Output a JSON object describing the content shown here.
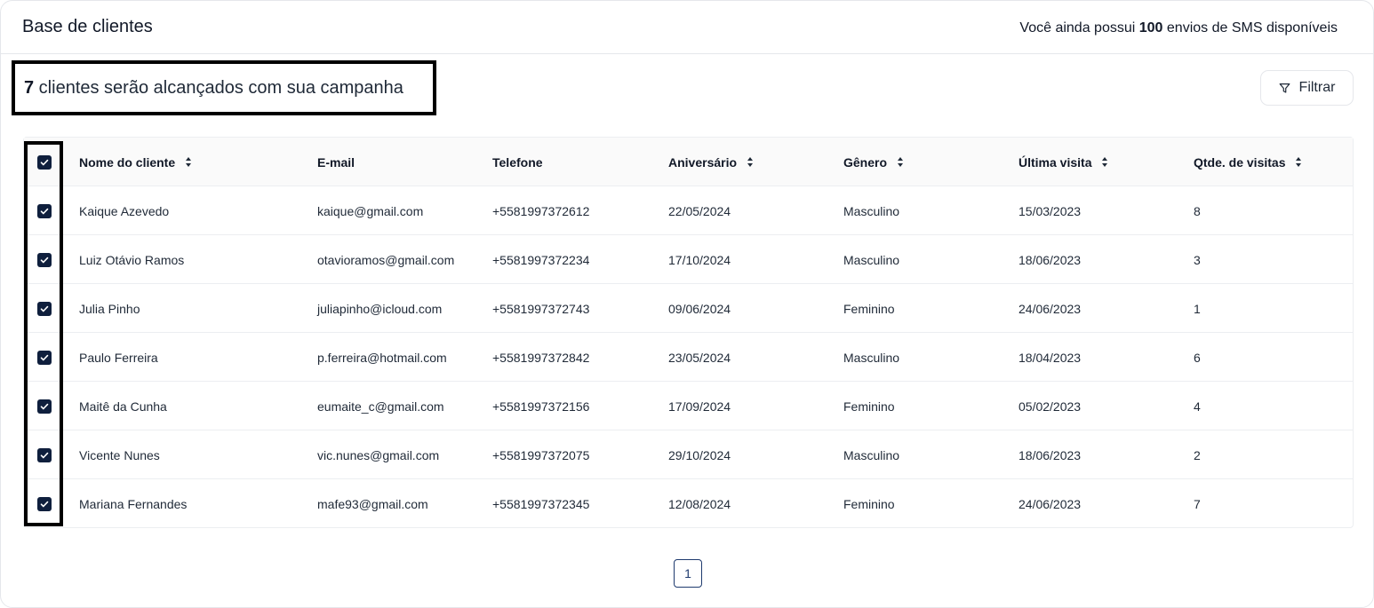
{
  "header": {
    "title": "Base de clientes",
    "sms_prefix": "Você ainda possui ",
    "sms_count": "100",
    "sms_suffix": " envios de SMS disponíveis"
  },
  "summary": {
    "count": "7",
    "text": " clientes serão alcançados com sua campanha"
  },
  "filter": {
    "label": "Filtrar",
    "icon": "filter-icon"
  },
  "table": {
    "columns": [
      {
        "label": "Nome do cliente",
        "sortable": true
      },
      {
        "label": "E-mail",
        "sortable": false
      },
      {
        "label": "Telefone",
        "sortable": false
      },
      {
        "label": "Aniversário",
        "sortable": true
      },
      {
        "label": "Gênero",
        "sortable": true
      },
      {
        "label": "Última visita",
        "sortable": true
      },
      {
        "label": "Qtde. de visitas",
        "sortable": true
      }
    ],
    "select_all_checked": true,
    "rows": [
      {
        "checked": true,
        "name": "Kaique Azevedo",
        "email": "kaique@gmail.com",
        "phone": "+5581997372612",
        "birthday": "22/05/2024",
        "gender": "Masculino",
        "last_visit": "15/03/2023",
        "visits": "8"
      },
      {
        "checked": true,
        "name": "Luiz Otávio Ramos",
        "email": "otavioramos@gmail.com",
        "phone": "+5581997372234",
        "birthday": "17/10/2024",
        "gender": "Masculino",
        "last_visit": "18/06/2023",
        "visits": "3"
      },
      {
        "checked": true,
        "name": "Julia Pinho",
        "email": "juliapinho@icloud.com",
        "phone": "+5581997372743",
        "birthday": "09/06/2024",
        "gender": "Feminino",
        "last_visit": "24/06/2023",
        "visits": "1"
      },
      {
        "checked": true,
        "name": "Paulo Ferreira",
        "email": "p.ferreira@hotmail.com",
        "phone": "+5581997372842",
        "birthday": "23/05/2024",
        "gender": "Masculino",
        "last_visit": "18/04/2023",
        "visits": "6"
      },
      {
        "checked": true,
        "name": "Maitê da Cunha",
        "email": "eumaite_c@gmail.com",
        "phone": "+5581997372156",
        "birthday": "17/09/2024",
        "gender": "Feminino",
        "last_visit": "05/02/2023",
        "visits": "4"
      },
      {
        "checked": true,
        "name": "Vicente Nunes",
        "email": "vic.nunes@gmail.com",
        "phone": "+5581997372075",
        "birthday": "29/10/2024",
        "gender": "Masculino",
        "last_visit": "18/06/2023",
        "visits": "2"
      },
      {
        "checked": true,
        "name": "Mariana Fernandes",
        "email": "mafe93@gmail.com",
        "phone": "+5581997372345",
        "birthday": "12/08/2024",
        "gender": "Feminino",
        "last_visit": "24/06/2023",
        "visits": "7"
      }
    ]
  },
  "pagination": {
    "current_page": "1"
  },
  "colors": {
    "checkbox": "#0f1f3d",
    "pager_accent": "#1e3a6e",
    "highlight_border": "#000000"
  }
}
